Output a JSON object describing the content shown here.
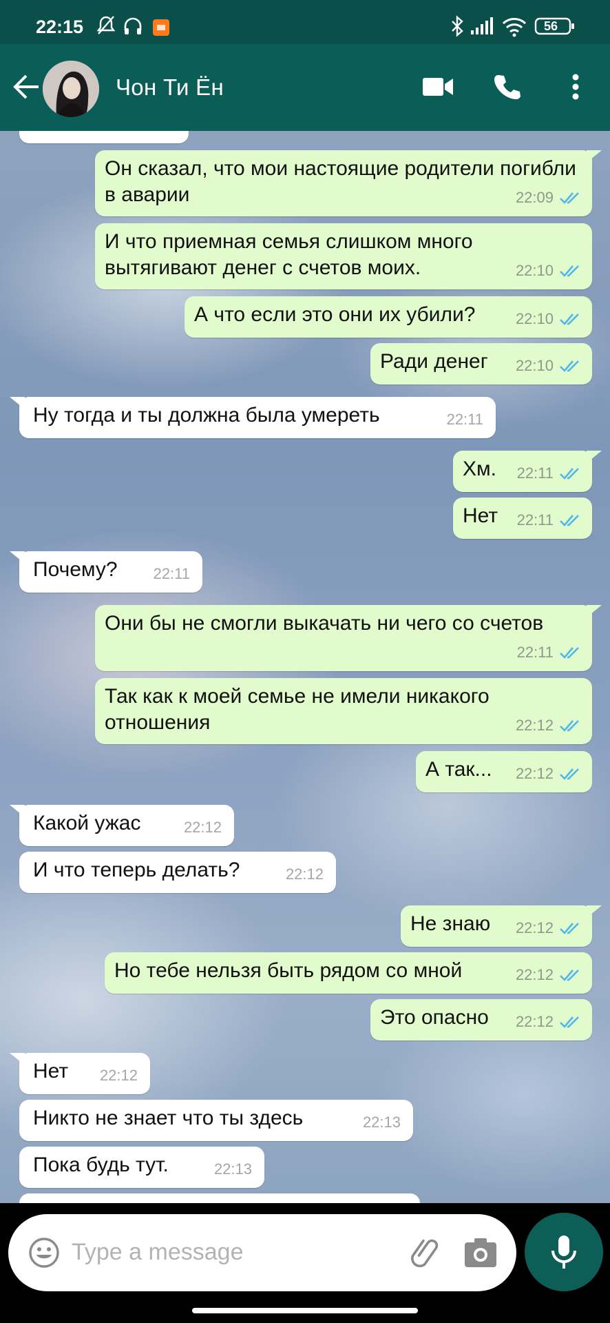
{
  "status": {
    "time": "22:15",
    "battery": "56"
  },
  "header": {
    "contact_name": "Чон Ти Ён"
  },
  "messages": [
    {
      "text": "Он сказал, что мои настоящие родители погибли в аварии",
      "time": "22:09"
    },
    {
      "text": "И что приемная семья слишком много вытягивают денег с счетов моих.",
      "time": "22:10"
    },
    {
      "text": "А что если это они их убили?",
      "time": "22:10"
    },
    {
      "text": "Ради денег",
      "time": "22:10"
    },
    {
      "text": "Ну тогда и ты должна была умереть",
      "time": "22:11"
    },
    {
      "text": "Хм.",
      "time": "22:11"
    },
    {
      "text": "Нет",
      "time": "22:11"
    },
    {
      "text": "Почему?",
      "time": "22:11"
    },
    {
      "text": "Они бы не смогли выкачать ни чего со счетов",
      "time": "22:11"
    },
    {
      "text": "Так как к моей семье не имели никакого отношения",
      "time": "22:12"
    },
    {
      "text": "А так...",
      "time": "22:12"
    },
    {
      "text": "Какой ужас",
      "time": "22:12"
    },
    {
      "text": "И что теперь делать?",
      "time": "22:12"
    },
    {
      "text": "Не знаю",
      "time": "22:12"
    },
    {
      "text": "Но тебе нельзя быть рядом со мной",
      "time": "22:12"
    },
    {
      "text": "Это опасно",
      "time": "22:12"
    },
    {
      "text": "Нет",
      "time": "22:12"
    },
    {
      "text": "Никто не знает что ты здесь",
      "time": "22:13"
    },
    {
      "text": "Пока будь тут.",
      "time": "22:13"
    }
  ],
  "input": {
    "placeholder": "Type a message"
  },
  "colors": {
    "header": "#0b5e58",
    "outgoing": "#e2fbcd",
    "incoming": "#ffffff",
    "tick": "#4fb6ec"
  }
}
